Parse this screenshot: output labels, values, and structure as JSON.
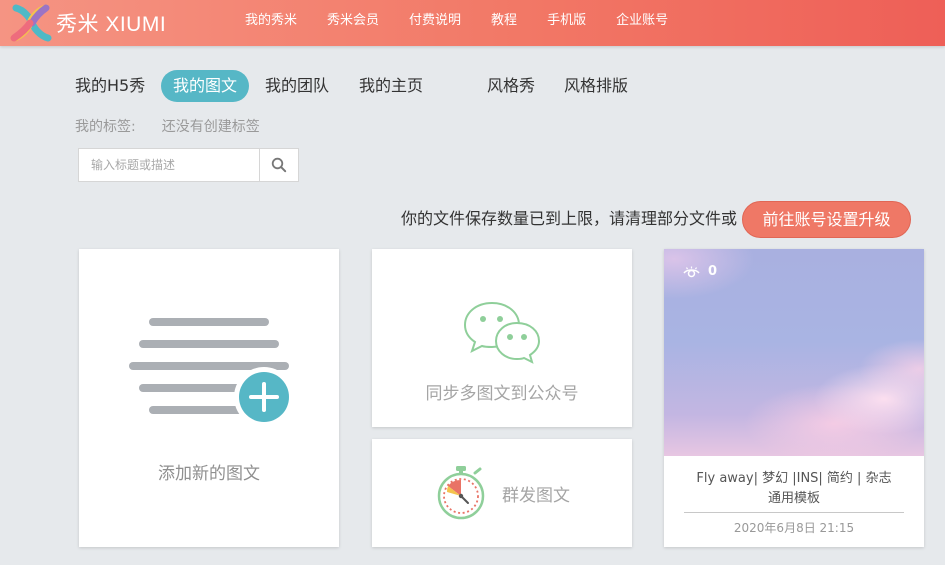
{
  "brand": {
    "name": "秀米 XIUMI",
    "accent": "#ef7866",
    "teal": "#56b7c6"
  },
  "topnav": {
    "items": [
      "我的秀米",
      "秀米会员",
      "付费说明",
      "教程",
      "手机版",
      "企业账号"
    ]
  },
  "tabs": {
    "items": [
      "我的H5秀",
      "我的图文",
      "我的团队",
      "我的主页",
      "风格秀",
      "风格排版"
    ],
    "active_index": 1
  },
  "tags": {
    "label": "我的标签:",
    "empty_text": "还没有创建标签"
  },
  "search": {
    "placeholder": "输入标题或描述",
    "icon": "search-icon"
  },
  "notice": {
    "text": "你的文件保存数量已到上限，请清理部分文件或",
    "button_label": "前往账号设置升级"
  },
  "cards": {
    "add": {
      "label": "添加新的图文",
      "icon": "document-add-icon"
    },
    "sync": {
      "label": "同步多图文到公众号",
      "icon": "wechat-icon"
    },
    "mass": {
      "label": "群发图文",
      "icon": "timer-icon"
    }
  },
  "template": {
    "views": "0",
    "title": "Fly away| 梦幻 |INS| 简约 | 杂志通用模板",
    "date": "2020年6月8日 21:15"
  }
}
